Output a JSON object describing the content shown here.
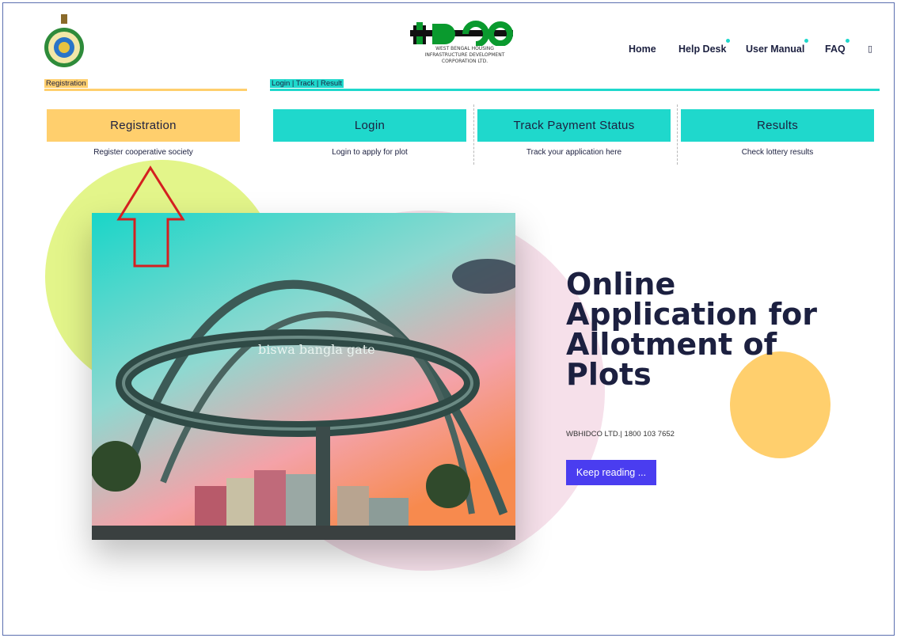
{
  "header": {
    "logo_lines": [
      "WEST BENGAL HOUSING",
      "INFRASTRUCTURE DEVELOPMENT",
      "CORPORATION LTD."
    ],
    "logo_brand": "HIDCO",
    "nav": [
      {
        "label": "Home"
      },
      {
        "label": "Help Desk"
      },
      {
        "label": "User Manual"
      },
      {
        "label": "FAQ"
      },
      {
        "label": "▯"
      }
    ]
  },
  "tabs": {
    "registration": "Registration",
    "login_track_result": "Login | Track | Result"
  },
  "cards": [
    {
      "label": "Registration",
      "description": "Register cooperative society"
    },
    {
      "label": "Login",
      "description": "Login to apply for plot"
    },
    {
      "label": "Track Payment Status",
      "description": "Track your application here"
    },
    {
      "label": "Results",
      "description": "Check lottery results"
    }
  ],
  "hero": {
    "title": "Online Application for Allotment of Plots",
    "subtitle": "WBHIDCO LTD.| 1800 103 7652",
    "cta": "Keep reading ...",
    "image_caption": "biswa bangla gate"
  },
  "colors": {
    "accent_teal": "#1fd8cc",
    "accent_yellow": "#ffcf6d",
    "cta_purple": "#4a3df0",
    "text_dark": "#1c2040"
  }
}
